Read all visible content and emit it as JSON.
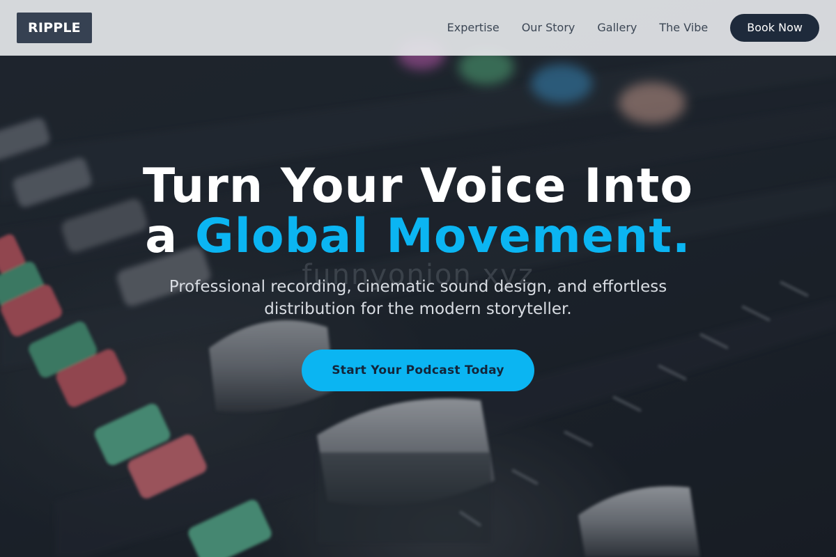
{
  "nav": {
    "logo": "RIPPLE",
    "links": [
      "Expertise",
      "Our Story",
      "Gallery",
      "The Vibe"
    ],
    "cta": "Book Now"
  },
  "hero": {
    "title_line1": "Turn Your Voice Into",
    "title_line2_prefix": "a ",
    "title_line2_accent": "Global Movement.",
    "watermark": "funnyonion.xyz",
    "subtitle": "Professional recording, cinematic sound design, and effortless distribution for the modern storyteller.",
    "cta": "Start Your Podcast Today"
  },
  "colors": {
    "accent": "#0bb5f2",
    "nav_button": "#1e2a3b",
    "logo_bg": "#364152"
  },
  "background": {
    "image": "audio-mixing-console-photo"
  }
}
